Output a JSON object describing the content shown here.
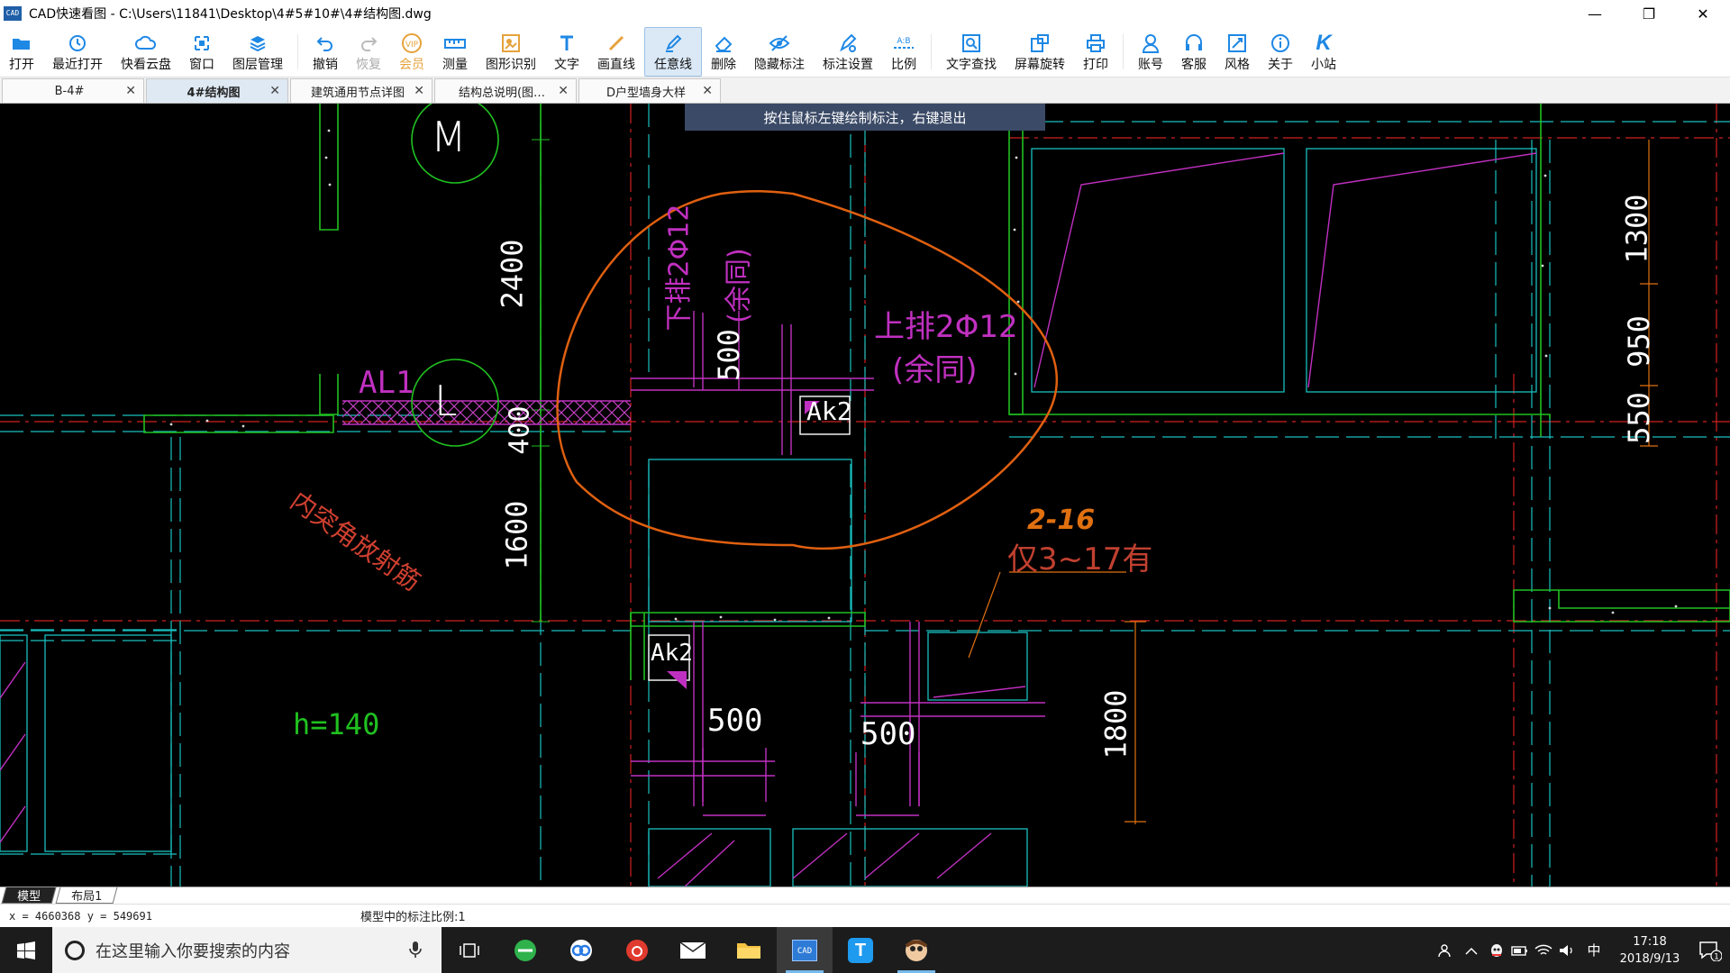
{
  "window": {
    "app_icon_text": "CAD",
    "title": "CAD快速看图 - C:\\Users\\11841\\Desktop\\4#5#10#\\4#结构图.dwg",
    "minimize": "—",
    "restore": "❐",
    "close": "✕"
  },
  "toolbar": [
    {
      "label": "打开",
      "icon": "folder-open-icon"
    },
    {
      "label": "最近打开",
      "icon": "recent-icon"
    },
    {
      "label": "快看云盘",
      "icon": "cloud-icon"
    },
    {
      "label": "窗口",
      "icon": "window-icon"
    },
    {
      "label": "图层管理",
      "icon": "layers-icon"
    },
    {
      "label": "撤销",
      "icon": "undo-icon"
    },
    {
      "label": "恢复",
      "icon": "redo-icon"
    },
    {
      "label": "会员",
      "icon": "vip-icon",
      "vip_text": "VIP"
    },
    {
      "label": "测量",
      "icon": "ruler-icon"
    },
    {
      "label": "图形识别",
      "icon": "shape-recognize-icon"
    },
    {
      "label": "文字",
      "icon": "text-icon"
    },
    {
      "label": "画直线",
      "icon": "line-icon"
    },
    {
      "label": "任意线",
      "icon": "freehand-pen-icon"
    },
    {
      "label": "删除",
      "icon": "eraser-icon"
    },
    {
      "label": "隐藏标注",
      "icon": "eye-hide-icon"
    },
    {
      "label": "标注设置",
      "icon": "annotation-settings-icon"
    },
    {
      "label": "比例",
      "icon": "scale-icon",
      "scale_text": "A:B"
    },
    {
      "label": "文字查找",
      "icon": "text-search-icon"
    },
    {
      "label": "屏幕旋转",
      "icon": "rotate-screen-icon"
    },
    {
      "label": "打印",
      "icon": "printer-icon"
    },
    {
      "label": "账号",
      "icon": "user-icon"
    },
    {
      "label": "客服",
      "icon": "headset-icon"
    },
    {
      "label": "风格",
      "icon": "style-icon"
    },
    {
      "label": "关于",
      "icon": "info-icon"
    },
    {
      "label": "小站",
      "icon": "k-station-icon",
      "glyph": "K"
    }
  ],
  "tabs": [
    {
      "label": "B-4#",
      "close": "✕"
    },
    {
      "label": "4#结构图",
      "close": "✕"
    },
    {
      "label": "建筑通用节点详图",
      "close": "✕"
    },
    {
      "label": "结构总说明(图…",
      "close": "✕"
    },
    {
      "label": "D户型墙身大样",
      "close": "✕"
    }
  ],
  "canvas": {
    "hint": "按住鼠标左键绘制标注，右键退出",
    "labels": {
      "axis_m": "M",
      "axis_l": "L",
      "al1": "AL1",
      "dim_2400": "2400",
      "dim_400": "400",
      "dim_1600": "1600",
      "dim_500_top": "500",
      "dim_500_a": "500",
      "dim_500_b": "500",
      "dim_1800": "1800",
      "dim_1300": "1300",
      "dim_950": "950",
      "dim_550": "550",
      "lower_bar": "下排2Φ12",
      "lower_bar_note": "(余同)",
      "upper_bar": "上排2Φ12",
      "upper_bar_note": "(余同)",
      "ak2_a": "Ak2",
      "ak2_b": "Ak2",
      "corner_note": "内突角放射筋",
      "h_value": "h=140",
      "note_floor": "仅3~17有",
      "note_orange": "2-16"
    }
  },
  "layout_tabs": [
    {
      "label": "模型"
    },
    {
      "label": "布局1"
    }
  ],
  "status": {
    "coords": "x = 4660368  y = 549691",
    "scale": "模型中的标注比例:1"
  },
  "taskbar": {
    "search_placeholder": "在这里输入你要搜索的内容",
    "apps": [
      "task-view-icon",
      "browser-360-icon",
      "baidu-netdisk-icon",
      "netease-music-icon",
      "mail-icon",
      "file-explorer-icon",
      "cad-viewer-icon",
      "tencent-t-icon",
      "avatar-app-icon"
    ],
    "cad_text": "CAD",
    "t_text": "T",
    "tray": {
      "ime": "中",
      "time": "17:18",
      "date": "2018/9/13",
      "notif_count": "1"
    }
  }
}
